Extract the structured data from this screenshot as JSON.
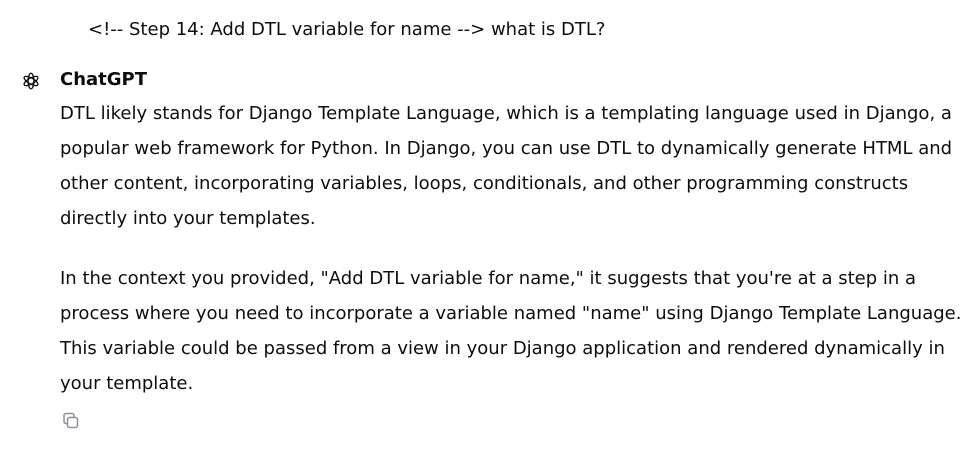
{
  "conversation": {
    "user_message": "<!-- Step 14: Add DTL variable for name --> what is DTL?",
    "assistant": {
      "name": "ChatGPT",
      "avatar_icon": "chatgpt-logo-icon",
      "paragraphs": [
        "DTL likely stands for Django Template Language, which is a templating language used in Django, a popular web framework for Python. In Django, you can use DTL to dynamically generate HTML and other content, incorporating variables, loops, conditionals, and other programming constructs directly into your templates.",
        "In the context you provided, \"Add DTL variable for name,\" it suggests that you're at a step in a process where you need to incorporate a variable named \"name\" using Django Template Language. This variable could be passed from a view in your Django application and rendered dynamically in your template."
      ],
      "actions": {
        "copy_icon": "copy-icon"
      }
    }
  }
}
